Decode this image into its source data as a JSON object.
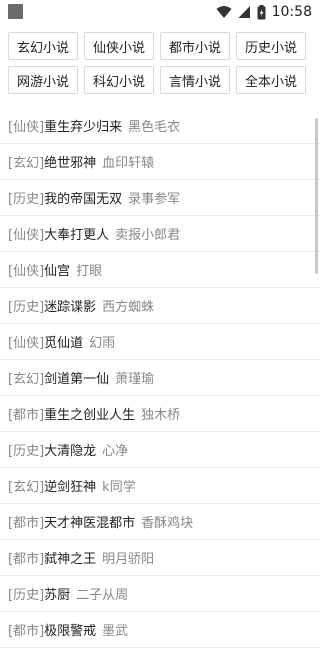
{
  "status": {
    "time": "10:58"
  },
  "categories": [
    {
      "label": "玄幻小说"
    },
    {
      "label": "仙侠小说"
    },
    {
      "label": "都市小说"
    },
    {
      "label": "历史小说"
    },
    {
      "label": "网游小说"
    },
    {
      "label": "科幻小说"
    },
    {
      "label": "言情小说"
    },
    {
      "label": "全本小说"
    }
  ],
  "books": [
    {
      "category": "[仙侠]",
      "title": "重生弃少归来",
      "author": "黑色毛衣"
    },
    {
      "category": "[玄幻]",
      "title": "绝世邪神",
      "author": "血印轩辕"
    },
    {
      "category": "[历史]",
      "title": "我的帝国无双",
      "author": "录事参军"
    },
    {
      "category": "[仙侠]",
      "title": "大奉打更人",
      "author": "卖报小郎君"
    },
    {
      "category": "[仙侠]",
      "title": "仙宫",
      "author": "打眼"
    },
    {
      "category": "[历史]",
      "title": "迷踪谍影",
      "author": "西方蜘蛛"
    },
    {
      "category": "[仙侠]",
      "title": "觅仙道",
      "author": "幻雨"
    },
    {
      "category": "[玄幻]",
      "title": "剑道第一仙",
      "author": "萧瑾瑜"
    },
    {
      "category": "[都市]",
      "title": "重生之创业人生",
      "author": "独木桥"
    },
    {
      "category": "[历史]",
      "title": "大清隐龙",
      "author": "心净"
    },
    {
      "category": "[玄幻]",
      "title": "逆剑狂神",
      "author": "k同学"
    },
    {
      "category": "[都市]",
      "title": "天才神医混都市",
      "author": "香酥鸡块"
    },
    {
      "category": "[都市]",
      "title": "弑神之王",
      "author": "明月骄阳"
    },
    {
      "category": "[历史]",
      "title": "苏厨",
      "author": "二子从周"
    },
    {
      "category": "[都市]",
      "title": "极限警戒",
      "author": "墨武"
    }
  ]
}
